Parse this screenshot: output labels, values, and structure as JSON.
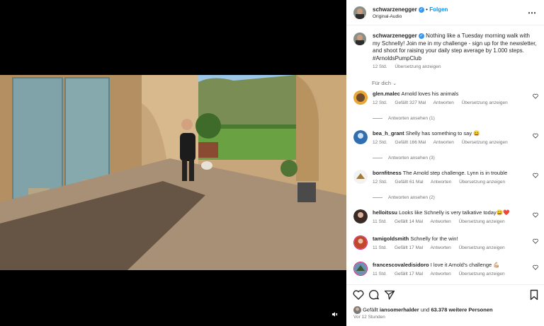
{
  "header": {
    "username": "schwarzenegger",
    "follow_label": "Folgen",
    "separator": "•",
    "audio": "Original-Audio"
  },
  "caption": {
    "username": "schwarzenegger",
    "text": "Nothing like a Tuesday morning walk with my Schnelly! Join me in my challenge - sign up for the newsletter, and shoot for raising your daily step average by 1.000 steps. #ArnoldsPumpClub",
    "time": "12 Std.",
    "translate": "Übersetzung anzeigen"
  },
  "for_you_label": "Für dich",
  "comments": [
    {
      "username": "glen.malec",
      "text": "Arnold loves his animals",
      "time": "12 Std.",
      "likes": "Gefällt 327 Mal",
      "reply": "Antworten",
      "translate": "Übersetzung anzeigen",
      "replies": "Antworten ansehen (1)"
    },
    {
      "username": "bea_h_grant",
      "text": "Shelly has something to say 😄",
      "time": "12 Std.",
      "likes": "Gefällt 166 Mal",
      "reply": "Antworten",
      "translate": "Übersetzung anzeigen",
      "replies": "Antworten ansehen (3)"
    },
    {
      "username": "bornfitness",
      "text": "The Arnold step challenge. Lynn is in trouble",
      "time": "12 Std.",
      "likes": "Gefällt 61 Mal",
      "reply": "Antworten",
      "translate": "Übersetzung anzeigen",
      "replies": "Antworten ansehen (2)"
    },
    {
      "username": "helloitssu",
      "text": "Looks like Schnelly is very talkative today😄❤️",
      "time": "11 Std.",
      "likes": "Gefällt 14 Mal",
      "reply": "Antworten",
      "translate": "Übersetzung anzeigen",
      "replies": ""
    },
    {
      "username": "tamigoldsmith",
      "text": "Schnelly for the win!",
      "time": "11 Std.",
      "likes": "Gefällt 17 Mal",
      "reply": "Antworten",
      "translate": "Übersetzung anzeigen",
      "replies": ""
    },
    {
      "username": "francescovaledisidoro",
      "text": "I love it Arnold's challenge 💪🏼",
      "time": "11 Std.",
      "likes": "Gefällt 17 Mal",
      "reply": "Antworten",
      "translate": "Übersetzung anzeigen",
      "replies": ""
    }
  ],
  "likes": {
    "prefix": "Gefällt",
    "user": "iansomerhalder",
    "and": "und",
    "others": "63.378 weitere Personen"
  },
  "posted_ago": "Vor 12 Stunden",
  "icons": {
    "heart": "heart-icon",
    "comment": "comment-icon",
    "share": "share-icon",
    "save": "bookmark-icon",
    "mute": "mute-icon",
    "more": "more-options-icon"
  },
  "colors": {
    "link_blue": "#0095f6",
    "verified_blue": "#3897f0",
    "muted_text": "#737373",
    "like_red": "#ed4956"
  }
}
